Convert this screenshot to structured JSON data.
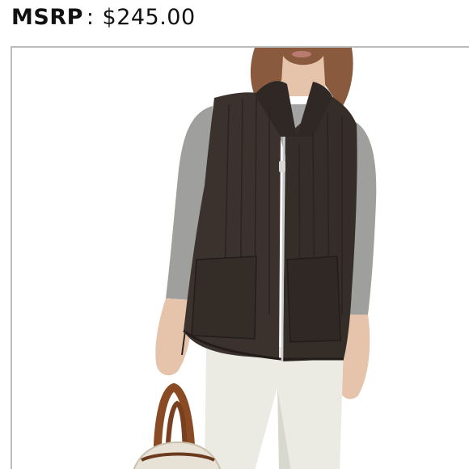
{
  "header": {
    "label": "MSRP",
    "separator": ":",
    "price": "$245.00"
  },
  "product_image": {
    "subject": "model-wearing-quilted-vest",
    "colors": {
      "vest": "#3b322d",
      "sweater": "#9fa09e",
      "pants": "#ecebe3",
      "hair": "#8a5a3e",
      "skin": "#e6c3ab",
      "bag_leather": "#8a4a24"
    }
  }
}
